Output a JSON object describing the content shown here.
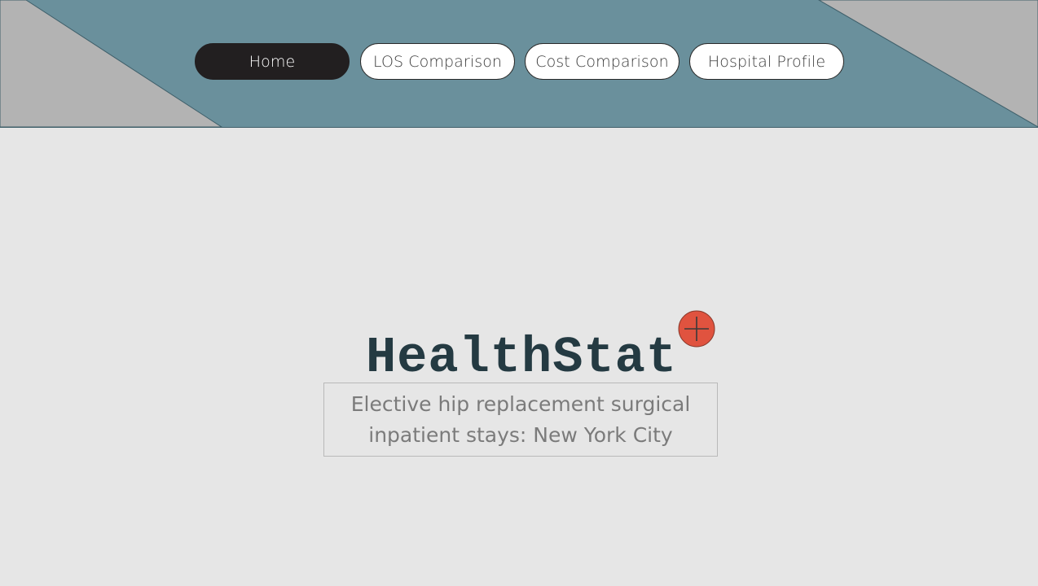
{
  "nav": {
    "items": [
      {
        "label": "Home",
        "active": true
      },
      {
        "label": "LOS Comparison",
        "active": false
      },
      {
        "label": "Cost Comparison",
        "active": false
      },
      {
        "label": "Hospital Profile",
        "active": false
      }
    ]
  },
  "brand": {
    "title": "HealthStat",
    "badge_icon": "plus-circle-icon",
    "badge_color": "#e0533f"
  },
  "subtitle": "Elective hip replacement surgical inpatient stays: New York City",
  "colors": {
    "header": "#6a909c",
    "header_corner": "#b3b3b3",
    "background": "#e6e6e6",
    "title": "#243a42",
    "active_nav": "#221f20"
  }
}
